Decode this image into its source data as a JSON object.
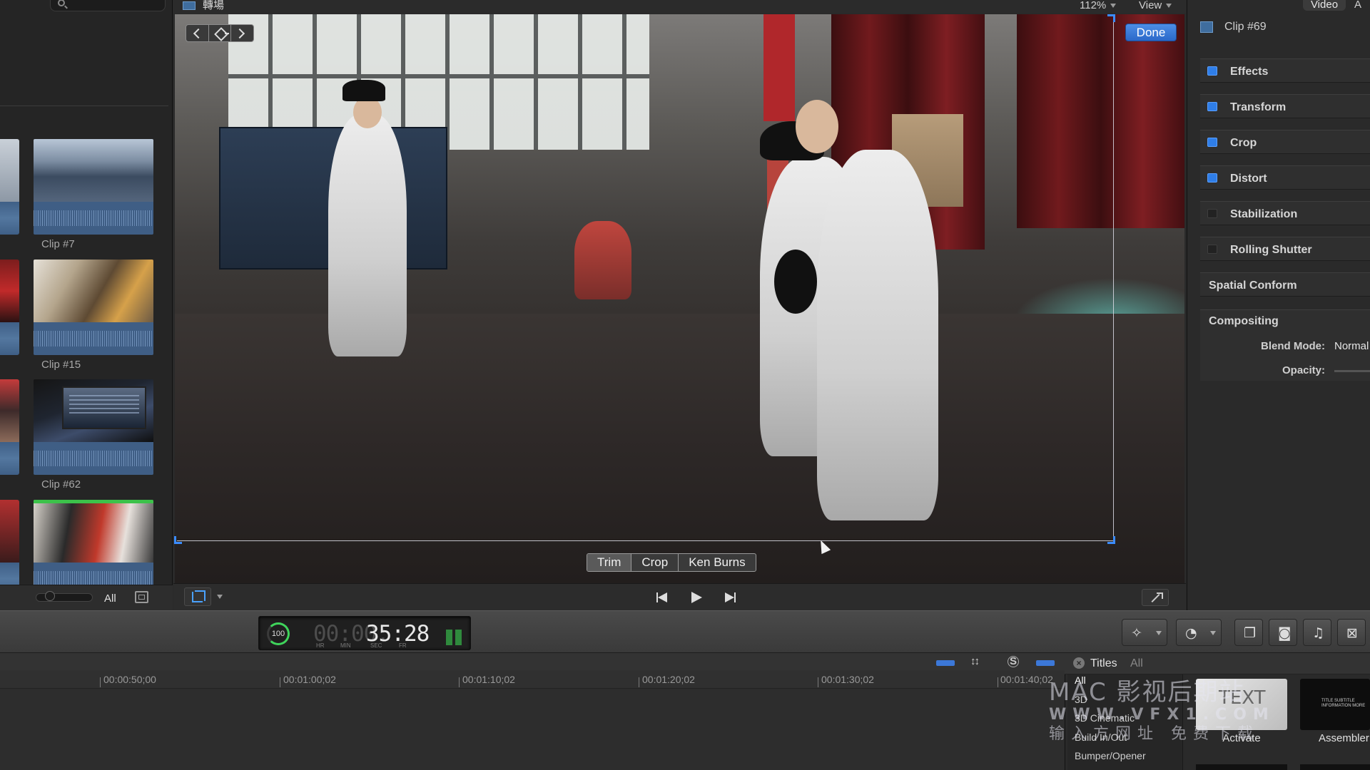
{
  "browser": {
    "filter_label": "All",
    "clips": [
      {
        "label": "Clip #7"
      },
      {
        "label": "Clip #15"
      },
      {
        "label": "Clip #62"
      },
      {
        "label": ""
      }
    ]
  },
  "viewer": {
    "title": "轉場",
    "zoom": "112%",
    "view_menu": "View",
    "done_label": "Done",
    "crop_modes": [
      "Trim",
      "Crop",
      "Ken Burns"
    ],
    "active_crop_mode": "Trim"
  },
  "inspector": {
    "tabs": [
      "Video",
      "A"
    ],
    "clip_title": "Clip #69",
    "sections": [
      {
        "label": "Effects",
        "enabled": true
      },
      {
        "label": "Transform",
        "enabled": true
      },
      {
        "label": "Crop",
        "enabled": true
      },
      {
        "label": "Distort",
        "enabled": true
      },
      {
        "label": "Stabilization",
        "enabled": false
      },
      {
        "label": "Rolling Shutter",
        "enabled": false
      },
      {
        "label": "Spatial Conform",
        "enabled": null
      }
    ],
    "compositing": {
      "label": "Compositing",
      "blend_mode_label": "Blend Mode:",
      "blend_mode_value": "Normal",
      "opacity_label": "Opacity:"
    }
  },
  "toolbar": {
    "timecode": {
      "percent": "100",
      "dim": "00:00:",
      "main": "35:28",
      "units": [
        "HR",
        "MIN",
        "SEC",
        "FR"
      ]
    }
  },
  "timeline": {
    "ruler": [
      "00:00:50;00",
      "00:01:00;02",
      "00:01:10;02",
      "00:01:20;02",
      "00:01:30;02",
      "00:01:40;02"
    ]
  },
  "titles_browser": {
    "label": "Titles",
    "filter": "All",
    "categories": [
      "All",
      "3D",
      "3D Cinematic",
      "Build In/Out",
      "Bumper/Opener"
    ],
    "selected_category": "All",
    "items": [
      {
        "name": "Activate",
        "thumb_text": "TEXT"
      },
      {
        "name": "Assembler",
        "thumb_text": "TITLE SUBTITLE INFORMATION MORE"
      }
    ]
  },
  "watermark": {
    "line1": "MAC 影视后期站",
    "line2": "WWW.VFX1.COM",
    "line3": "输入方网址 免费下载"
  }
}
